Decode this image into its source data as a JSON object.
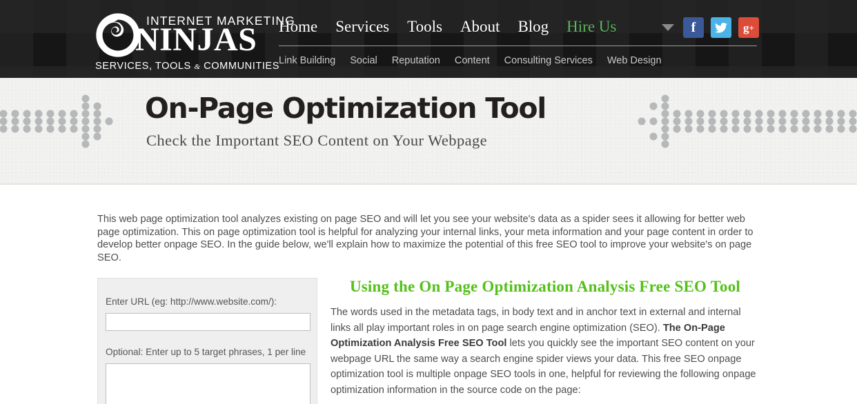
{
  "header": {
    "logo": {
      "top_line": "INTERNET MARKETING",
      "main_line": "NINJAS",
      "sub_line_pre": "SERVICES, TOOLS ",
      "sub_line_amp": "&",
      "sub_line_post": " COMMUNITIES",
      "mark_icon": "swirl-logo-icon"
    },
    "main_nav": [
      {
        "label": "Home",
        "accent": false
      },
      {
        "label": "Services",
        "accent": false
      },
      {
        "label": "Tools",
        "accent": false
      },
      {
        "label": "About",
        "accent": false
      },
      {
        "label": "Blog",
        "accent": false
      },
      {
        "label": "Hire Us",
        "accent": true
      }
    ],
    "sub_nav": [
      "Link Building",
      "Social",
      "Reputation",
      "Content",
      "Consulting Services",
      "Web Design"
    ],
    "social": [
      {
        "name": "facebook-icon",
        "glyph": "f",
        "color": "#3b5998"
      },
      {
        "name": "twitter-icon",
        "glyph": "ᴠ",
        "color": "#4ab3e8"
      },
      {
        "name": "google-plus-icon",
        "glyph": "g+",
        "color": "#dd4b39"
      }
    ],
    "dropdown_icon": "chevron-down-icon",
    "accent_green": "#5cb85c"
  },
  "hero": {
    "title": "On-Page Optimization Tool",
    "subtitle": "Check the Important SEO Content on Your Webpage",
    "left_decoration": "dotted-arrow-right-icon",
    "right_decoration": "dotted-arrow-left-icon",
    "background_color": "#f1f1ef"
  },
  "intro": {
    "paragraph": "This web page optimization tool analyzes existing on page SEO and will let you see your website's data as a spider sees it allowing for better web page optimization. This on page optimization tool is helpful for analyzing your internal links, your meta information and your page content in order to develop better onpage SEO. In the guide below, we'll explain how to maximize the potential of this free SEO tool to improve your website's on page SEO."
  },
  "form": {
    "url_label": "Enter URL (eg: http://www.website.com/):",
    "url_value": "",
    "url_placeholder": "",
    "phrases_label": "Optional: Enter up to 5 target phrases, 1 per line",
    "phrases_value": "",
    "phrases_placeholder": ""
  },
  "guide": {
    "heading": "Using the On Page Optimization Analysis Free SEO Tool",
    "heading_color": "#54c01a",
    "body_part1": "The words used in the metadata tags, in body text and in anchor text in external and internal links all play important roles in on page search engine optimization (SEO). ",
    "body_bold": "The On-Page Optimization Analysis Free SEO Tool",
    "body_part2": " lets you quickly see the important SEO content on your webpage URL the same way a search engine spider views your data. This free SEO onpage optimization tool is multiple onpage SEO tools in one, helpful for reviewing the following onpage optimization information in the source code on the page:"
  }
}
